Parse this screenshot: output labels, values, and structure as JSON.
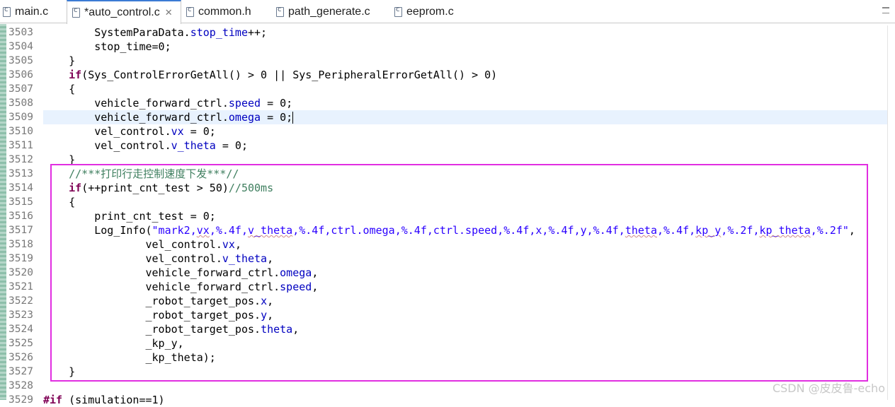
{
  "tabs": [
    {
      "label": "main.c",
      "active": false
    },
    {
      "label": "*auto_control.c",
      "active": true
    },
    {
      "label": "common.h",
      "active": false
    },
    {
      "label": "path_generate.c",
      "active": false
    },
    {
      "label": "eeprom.c",
      "active": false
    }
  ],
  "editor": {
    "lines": [
      {
        "num": "3503",
        "indent": "        ",
        "tokens": [
          [
            "t",
            "SystemParaData."
          ],
          [
            "f",
            "stop_time"
          ],
          [
            "t",
            "++;"
          ]
        ]
      },
      {
        "num": "3504",
        "indent": "        ",
        "tokens": [
          [
            "t",
            "stop_time=0;"
          ]
        ]
      },
      {
        "num": "3505",
        "indent": "    ",
        "tokens": [
          [
            "t",
            "}"
          ]
        ]
      },
      {
        "num": "3506",
        "indent": "    ",
        "tokens": [
          [
            "k",
            "if"
          ],
          [
            "t",
            "(Sys_ControlErrorGetAll() > 0 || Sys_PeripheralErrorGetAll() > 0)"
          ]
        ]
      },
      {
        "num": "3507",
        "indent": "    ",
        "tokens": [
          [
            "t",
            "{"
          ]
        ]
      },
      {
        "num": "3508",
        "indent": "        ",
        "tokens": [
          [
            "t",
            "vehicle_forward_ctrl."
          ],
          [
            "f",
            "speed"
          ],
          [
            "t",
            " = 0;"
          ]
        ]
      },
      {
        "num": "3509",
        "indent": "        ",
        "tokens": [
          [
            "t",
            "vehicle_forward_ctrl."
          ],
          [
            "f",
            "omega"
          ],
          [
            "t",
            " = 0;"
          ]
        ],
        "current": true
      },
      {
        "num": "3510",
        "indent": "        ",
        "tokens": [
          [
            "t",
            "vel_control."
          ],
          [
            "f",
            "vx"
          ],
          [
            "t",
            " = 0;"
          ]
        ]
      },
      {
        "num": "3511",
        "indent": "        ",
        "tokens": [
          [
            "t",
            "vel_control."
          ],
          [
            "f",
            "v_theta"
          ],
          [
            "t",
            " = 0;"
          ]
        ]
      },
      {
        "num": "3512",
        "indent": "    ",
        "tokens": [
          [
            "t",
            "}"
          ]
        ]
      },
      {
        "num": "3513",
        "indent": "    ",
        "tokens": [
          [
            "c",
            "//***打印行走控制速度下发***//"
          ]
        ]
      },
      {
        "num": "3514",
        "indent": "    ",
        "tokens": [
          [
            "k",
            "if"
          ],
          [
            "t",
            "(++print_cnt_test > 50)"
          ],
          [
            "c",
            "//500ms"
          ]
        ]
      },
      {
        "num": "3515",
        "indent": "    ",
        "tokens": [
          [
            "t",
            "{"
          ]
        ]
      },
      {
        "num": "3516",
        "indent": "        ",
        "tokens": [
          [
            "t",
            "print_cnt_test = 0;"
          ]
        ]
      },
      {
        "num": "3517",
        "indent": "        ",
        "tokens": [
          [
            "t",
            "Log_Info("
          ],
          [
            "s",
            "\"mark2,"
          ],
          [
            "su",
            "vx"
          ],
          [
            "s",
            ",%.4f,"
          ],
          [
            "su",
            "v_theta"
          ],
          [
            "s",
            ",%.4f,ctrl.omega,%.4f,ctrl.speed,%.4f,x,%.4f,y,%.4f,"
          ],
          [
            "su",
            "theta"
          ],
          [
            "s",
            ",%.4f,"
          ],
          [
            "su",
            "kp_y"
          ],
          [
            "s",
            ",%.2f,"
          ],
          [
            "su",
            "kp_theta"
          ],
          [
            "s",
            ",%.2f\""
          ],
          [
            "t",
            ","
          ]
        ]
      },
      {
        "num": "3518",
        "indent": "                ",
        "tokens": [
          [
            "t",
            "vel_control."
          ],
          [
            "f",
            "vx"
          ],
          [
            "t",
            ","
          ]
        ]
      },
      {
        "num": "3519",
        "indent": "                ",
        "tokens": [
          [
            "t",
            "vel_control."
          ],
          [
            "f",
            "v_theta"
          ],
          [
            "t",
            ","
          ]
        ]
      },
      {
        "num": "3520",
        "indent": "                ",
        "tokens": [
          [
            "t",
            "vehicle_forward_ctrl."
          ],
          [
            "f",
            "omega"
          ],
          [
            "t",
            ","
          ]
        ]
      },
      {
        "num": "3521",
        "indent": "                ",
        "tokens": [
          [
            "t",
            "vehicle_forward_ctrl."
          ],
          [
            "f",
            "speed"
          ],
          [
            "t",
            ","
          ]
        ]
      },
      {
        "num": "3522",
        "indent": "                ",
        "tokens": [
          [
            "t",
            "_robot_target_pos."
          ],
          [
            "f",
            "x"
          ],
          [
            "t",
            ","
          ]
        ]
      },
      {
        "num": "3523",
        "indent": "                ",
        "tokens": [
          [
            "t",
            "_robot_target_pos."
          ],
          [
            "f",
            "y"
          ],
          [
            "t",
            ","
          ]
        ]
      },
      {
        "num": "3524",
        "indent": "                ",
        "tokens": [
          [
            "t",
            "_robot_target_pos."
          ],
          [
            "f",
            "theta"
          ],
          [
            "t",
            ","
          ]
        ]
      },
      {
        "num": "3525",
        "indent": "                ",
        "tokens": [
          [
            "t",
            "_kp_y,"
          ]
        ]
      },
      {
        "num": "3526",
        "indent": "                ",
        "tokens": [
          [
            "t",
            "_kp_theta);"
          ]
        ]
      },
      {
        "num": "3527",
        "indent": "    ",
        "tokens": [
          [
            "t",
            "}"
          ]
        ]
      },
      {
        "num": "3528",
        "indent": "",
        "tokens": []
      },
      {
        "num": "3529",
        "indent": "",
        "tokens": [
          [
            "k",
            "#if"
          ],
          [
            "t",
            " (simulation==1)"
          ]
        ]
      }
    ]
  },
  "watermark": "CSDN @皮皮鲁-echo",
  "colors": {
    "keyword": "#7f0055",
    "field": "#0000c0",
    "string": "#2a00ff",
    "comment": "#3f7f5f",
    "highlight_box": "#e12ee1",
    "current_line": "#e8f2fe"
  }
}
